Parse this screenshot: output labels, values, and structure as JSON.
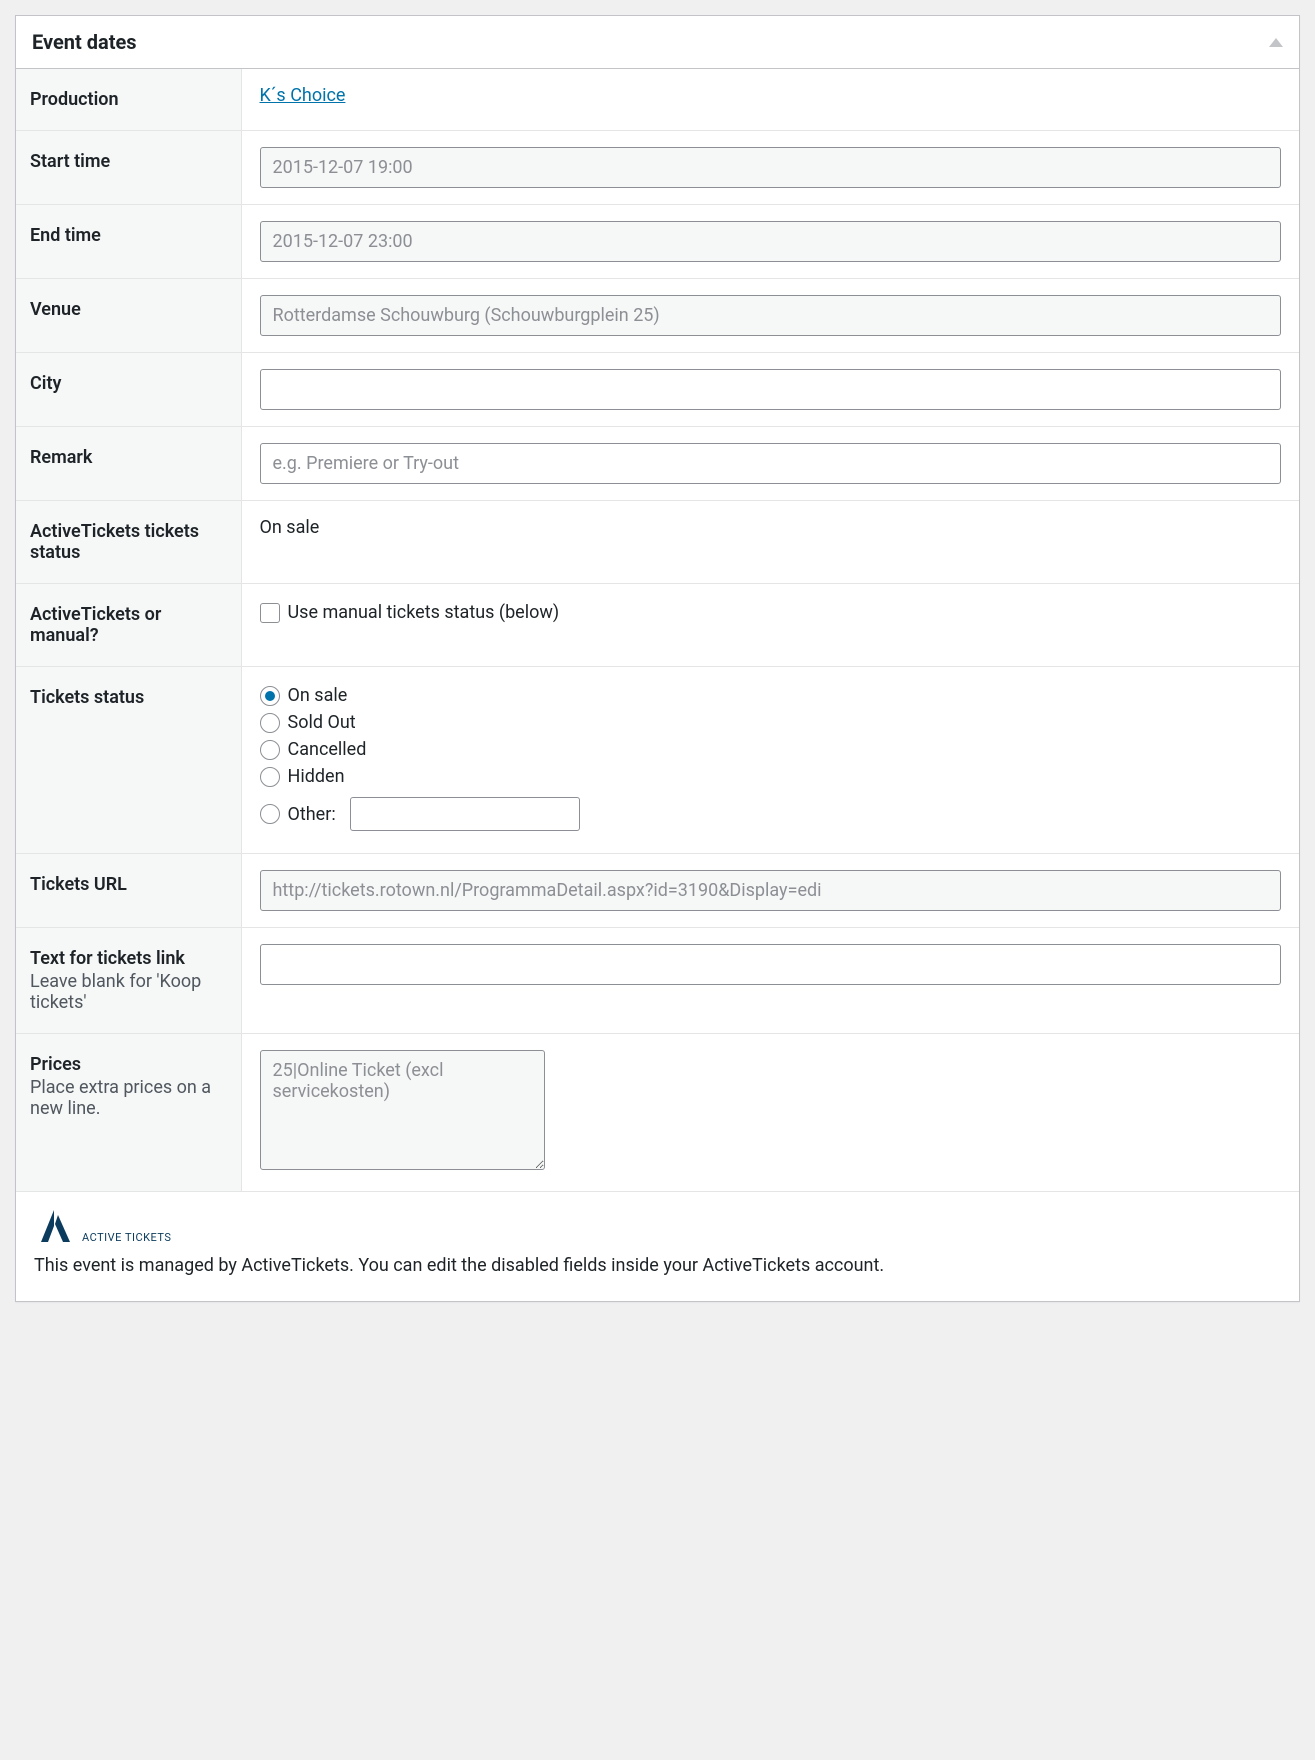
{
  "panel": {
    "title": "Event dates"
  },
  "rows": {
    "production": {
      "label": "Production",
      "link": "K´s Choice"
    },
    "start_time": {
      "label": "Start time",
      "value": "2015-12-07 19:00"
    },
    "end_time": {
      "label": "End time",
      "value": "2015-12-07 23:00"
    },
    "venue": {
      "label": "Venue",
      "value": "Rotterdamse Schouwburg (Schouwburgplein 25)"
    },
    "city": {
      "label": "City",
      "value": ""
    },
    "remark": {
      "label": "Remark",
      "placeholder": "e.g. Premiere or Try-out",
      "value": ""
    },
    "at_status": {
      "label": "ActiveTickets tickets status",
      "value": "On sale"
    },
    "at_or_manual": {
      "label": "ActiveTickets or manual?",
      "checkbox_label": "Use manual tickets status (below)"
    },
    "tickets_status": {
      "label": "Tickets status",
      "options": [
        "On sale",
        "Sold Out",
        "Cancelled",
        "Hidden"
      ],
      "other_label": "Other:",
      "selected": "On sale"
    },
    "tickets_url": {
      "label": "Tickets URL",
      "value": "http://tickets.rotown.nl/ProgrammaDetail.aspx?id=3190&Display=edi"
    },
    "tickets_link_text": {
      "label": "Text for tickets link",
      "hint": "Leave blank for 'Koop tickets'",
      "value": ""
    },
    "prices": {
      "label": "Prices",
      "hint": "Place extra prices on a new line.",
      "value": "25|Online Ticket (excl servicekosten)"
    }
  },
  "footer": {
    "brand": "ACTIVE TICKETS",
    "message": "This event is managed by ActiveTickets. You can edit the disabled fields inside your ActiveTickets account."
  }
}
